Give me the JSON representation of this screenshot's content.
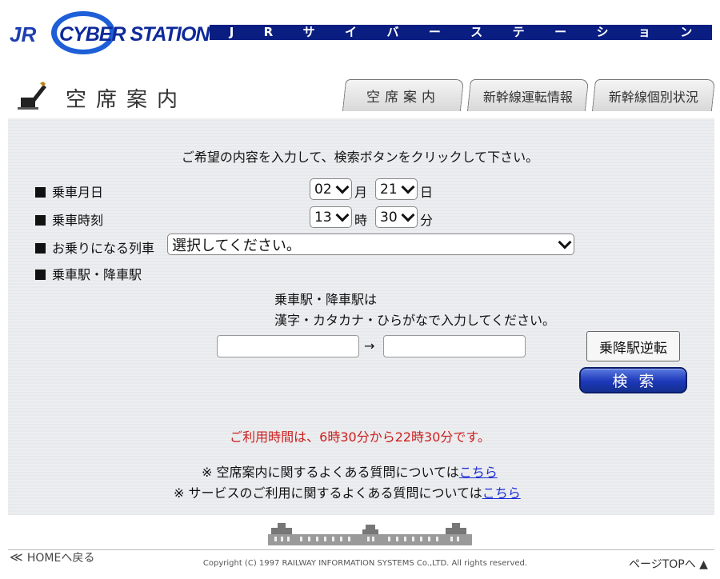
{
  "header": {
    "logo_text": "JR CYBER STATION",
    "banner_chars": [
      "J",
      "R",
      "サ",
      "イ",
      "バ",
      "ー",
      "ス",
      "テ",
      "ー",
      "シ",
      "ョ",
      "ン"
    ],
    "banner_color": "#0a1e82"
  },
  "page": {
    "title": "空席案内",
    "title_icon": "pen-icon",
    "tabs": [
      {
        "label": "空席案内"
      },
      {
        "label": "新幹線運転情報"
      },
      {
        "label": "新幹線個別状況"
      }
    ]
  },
  "form": {
    "instruction": "ご希望の内容を入力して、検索ボタンをクリックして下さい。",
    "date_label": "乗車月日",
    "month_value": "02",
    "month_unit": "月",
    "day_value": "21",
    "day_unit": "日",
    "time_label": "乗車時刻",
    "hour_value": "13",
    "hour_unit": "時",
    "minute_value": "30",
    "minute_unit": "分",
    "train_label": "お乗りになる列車",
    "train_value": "選択してください。",
    "station_label": "乗車駅・降車駅",
    "station_hint_1": "乗車駅・降車駅は",
    "station_hint_2": "漢字・カタカナ・ひらがなで入力してください。",
    "from_value": "",
    "to_value": "",
    "arrow": "→",
    "swap_label": "乗降駅逆転",
    "search_label": "検索"
  },
  "notice": {
    "hours": "ご利用時間は、6時30分から22時30分です。",
    "accent_color": "#cc1e1e"
  },
  "faq": {
    "line1_text": "※ 空席案内に関するよくある質問については",
    "line1_link": "こちら",
    "line2_text": "※ サービスのご利用に関するよくある質問については",
    "line2_link": "こちら"
  },
  "footer": {
    "home_label": "HOMEへ戻る",
    "copyright": "Copyright (C) 1997 RAILWAY INFORMATION SYSTEMS Co.,LTD. All rights reserved.",
    "top_label": "ページTOPへ"
  }
}
